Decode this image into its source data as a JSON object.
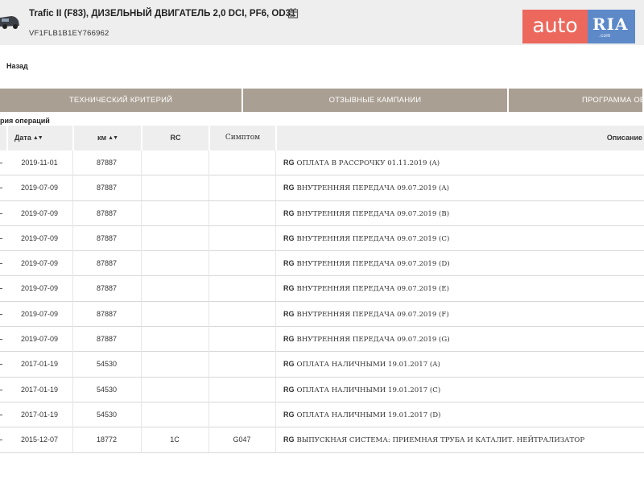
{
  "header": {
    "title": "Trafic II (F83), ДИЗЕЛЬНЫЙ ДВИГАТЕЛЬ 2,0 DCI, PF6, OD31",
    "vin": "VF1FLB1B1EY766962",
    "icons": {
      "car": "car-thumbnail-icon",
      "calendar": "calendar-icon"
    }
  },
  "logo": {
    "auto": "auto",
    "ria": "RIA",
    "ria_sub": ".com",
    "colors": {
      "auto_bg": "#e8473a",
      "ria_bg": "#3a6fbd"
    }
  },
  "nav": {
    "back_label": "Назад"
  },
  "tabs": [
    {
      "label": "ТЕХНИЧЕСКИЙ КРИТЕРИЙ"
    },
    {
      "label": "ОТЗЫВНЫЕ КАМПАНИИ"
    },
    {
      "label": "ПРОГРАММА ОБ"
    }
  ],
  "section": {
    "label": "рия операций"
  },
  "table": {
    "columns": [
      {
        "label": "Дата",
        "sortable": true
      },
      {
        "label": "км",
        "sortable": true
      },
      {
        "label": "RC",
        "sortable": false
      },
      {
        "label": "Симптом",
        "sortable": false
      },
      {
        "label": "Описание",
        "sortable": false
      }
    ],
    "rows": [
      {
        "date": "2019-11-01",
        "km": "87887",
        "rc": "",
        "symptom": "",
        "code": "RG",
        "desc": "ОПЛАТА В РАССРОЧКУ 01.11.2019 (A)"
      },
      {
        "date": "2019-07-09",
        "km": "87887",
        "rc": "",
        "symptom": "",
        "code": "RG",
        "desc": "ВНУТРЕННЯЯ ПЕРЕДАЧА 09.07.2019 (A)"
      },
      {
        "date": "2019-07-09",
        "km": "87887",
        "rc": "",
        "symptom": "",
        "code": "RG",
        "desc": "ВНУТРЕННЯЯ ПЕРЕДАЧА 09.07.2019 (B)"
      },
      {
        "date": "2019-07-09",
        "km": "87887",
        "rc": "",
        "symptom": "",
        "code": "RG",
        "desc": "ВНУТРЕННЯЯ ПЕРЕДАЧА 09.07.2019 (C)"
      },
      {
        "date": "2019-07-09",
        "km": "87887",
        "rc": "",
        "symptom": "",
        "code": "RG",
        "desc": "ВНУТРЕННЯЯ ПЕРЕДАЧА 09.07.2019 (D)"
      },
      {
        "date": "2019-07-09",
        "km": "87887",
        "rc": "",
        "symptom": "",
        "code": "RG",
        "desc": "ВНУТРЕННЯЯ ПЕРЕДАЧА 09.07.2019 (E)"
      },
      {
        "date": "2019-07-09",
        "km": "87887",
        "rc": "",
        "symptom": "",
        "code": "RG",
        "desc": "ВНУТРЕННЯЯ ПЕРЕДАЧА 09.07.2019 (F)"
      },
      {
        "date": "2019-07-09",
        "km": "87887",
        "rc": "",
        "symptom": "",
        "code": "RG",
        "desc": "ВНУТРЕННЯЯ ПЕРЕДАЧА 09.07.2019 (G)"
      },
      {
        "date": "2017-01-19",
        "km": "54530",
        "rc": "",
        "symptom": "",
        "code": "RG",
        "desc": "ОПЛАТА НАЛИЧНЫМИ 19.01.2017 (A)"
      },
      {
        "date": "2017-01-19",
        "km": "54530",
        "rc": "",
        "symptom": "",
        "code": "RG",
        "desc": "ОПЛАТА НАЛИЧНЫМИ 19.01.2017 (C)"
      },
      {
        "date": "2017-01-19",
        "km": "54530",
        "rc": "",
        "symptom": "",
        "code": "RG",
        "desc": "ОПЛАТА НАЛИЧНЫМИ 19.01.2017 (D)"
      },
      {
        "date": "2015-12-07",
        "km": "18772",
        "rc": "1C",
        "symptom": "G047",
        "code": "RG",
        "desc": "ВЫПУСКНАЯ СИСТЕМА: ПРИЕМНАЯ ТРУБА И КАТАЛИТ. НЕЙТРАЛИЗАТОР"
      }
    ]
  }
}
